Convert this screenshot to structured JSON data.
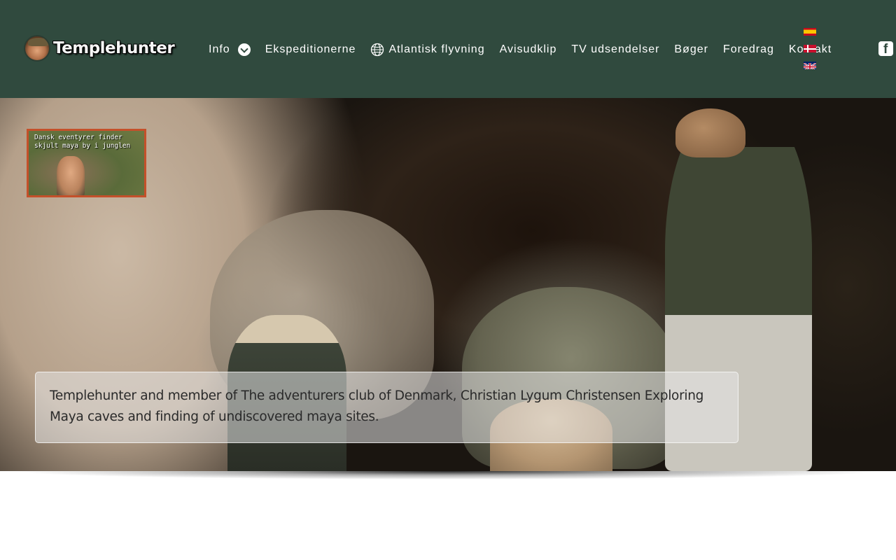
{
  "header": {
    "logo_text": "Templehunter",
    "nav": [
      {
        "label": "Info",
        "has_dropdown": true
      },
      {
        "label": "Ekspeditionerne"
      },
      {
        "label": "Atlantisk flyvning",
        "icon": "globe-icon"
      },
      {
        "label": "Avisudklip"
      },
      {
        "label": "TV udsendelser"
      },
      {
        "label": "Bøger"
      },
      {
        "label": "Foredrag"
      },
      {
        "label": "Kontakt"
      }
    ],
    "languages": [
      "es",
      "da",
      "en"
    ],
    "social_icon": "facebook-icon",
    "background_color": "#304a3e"
  },
  "hero": {
    "video_thumbnail_text": "Dansk eventyrer finder\nskjult maya by i junglen",
    "thumbnail_border_color": "#c4502a",
    "caption": "Templehunter and member of The adventurers club of Denmark, Christian Lygum Christensen Exploring Maya caves and finding of undiscovered maya sites."
  }
}
